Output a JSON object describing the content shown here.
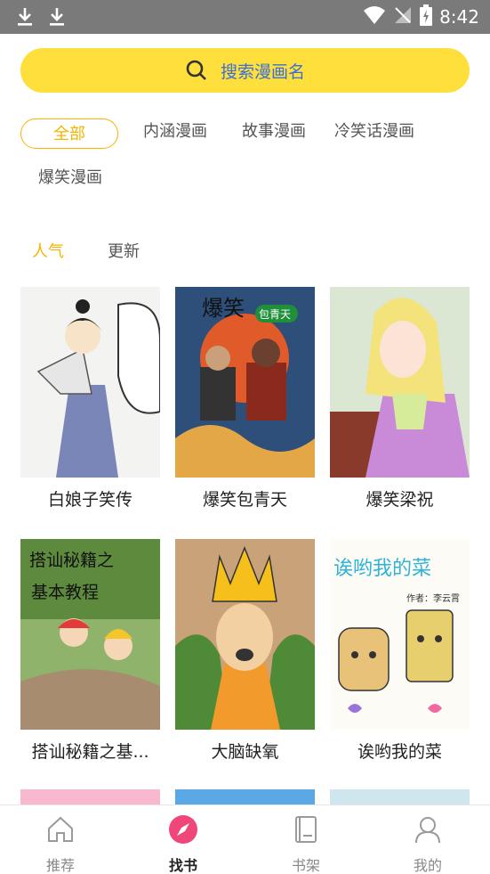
{
  "status_bar": {
    "time": "8:42",
    "icons": [
      "download-icon",
      "download-icon",
      "wifi-icon",
      "no-signal-icon",
      "battery-charging-icon"
    ]
  },
  "search": {
    "placeholder": "搜索漫画名",
    "icon": "search-icon",
    "accent_color": "#ffdf3c",
    "text_color": "#3a6fd8"
  },
  "categories": [
    {
      "label": "全部",
      "selected": true
    },
    {
      "label": "内涵漫画",
      "selected": false
    },
    {
      "label": "故事漫画",
      "selected": false
    },
    {
      "label": "冷笑话漫画",
      "selected": false
    },
    {
      "label": "爆笑漫画",
      "selected": false
    }
  ],
  "sort_tabs": [
    {
      "label": "人气",
      "selected": true
    },
    {
      "label": "更新",
      "selected": false
    }
  ],
  "comics": [
    {
      "title": "白娘子笑传"
    },
    {
      "title": "爆笑包青天",
      "cover_text": [
        "爆笑",
        "包青天"
      ]
    },
    {
      "title": "爆笑梁祝"
    },
    {
      "title": "搭讪秘籍之基...",
      "cover_text": [
        "搭讪秘籍之",
        "基本教程"
      ]
    },
    {
      "title": "大脑缺氧"
    },
    {
      "title": "诶哟我的菜",
      "cover_text": [
        "诶哟我的菜",
        "作者：李云霄"
      ]
    }
  ],
  "bottom_nav": [
    {
      "label": "推荐",
      "icon": "home-icon",
      "active": false
    },
    {
      "label": "找书",
      "icon": "compass-icon",
      "active": true
    },
    {
      "label": "书架",
      "icon": "book-icon",
      "active": false
    },
    {
      "label": "我的",
      "icon": "user-icon",
      "active": false
    }
  ],
  "colors": {
    "accent": "#f5b400",
    "active_nav": "#f0467a"
  }
}
